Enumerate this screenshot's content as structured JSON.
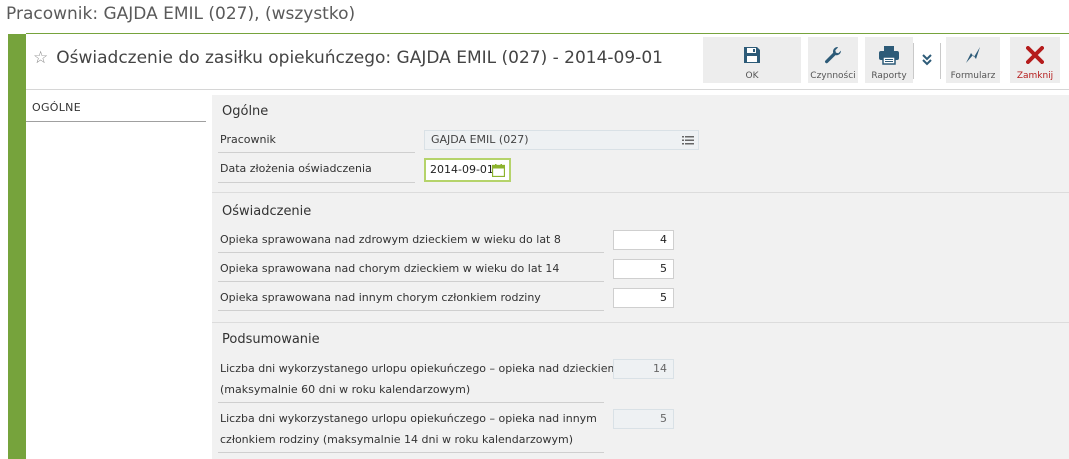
{
  "window": {
    "title": "Pracownik: GAJDA EMIL (027), (wszystko)"
  },
  "form": {
    "title": "Oświadczenie do zasiłku opiekuńczego: GAJDA EMIL (027) - 2014-09-01"
  },
  "toolbar": {
    "ok": "OK",
    "czynnosci": "Czynności",
    "raporty": "Raporty",
    "formularz": "Formularz",
    "zamknij": "Zamknij"
  },
  "sidebar": {
    "items": [
      {
        "label": "OGÓLNE"
      }
    ]
  },
  "sections": {
    "ogolne": {
      "title": "Ogólne",
      "pracownik_label": "Pracownik",
      "pracownik_value": "GAJDA EMIL (027)",
      "data_label": "Data złożenia oświadczenia",
      "data_value": "2014-09-01"
    },
    "oswiadczenie": {
      "title": "Oświadczenie",
      "rows": [
        {
          "label": "Opieka sprawowana nad zdrowym dzieckiem w wieku do lat 8",
          "value": "4"
        },
        {
          "label": "Opieka sprawowana nad chorym dzieckiem w wieku do lat 14",
          "value": "5"
        },
        {
          "label": "Opieka sprawowana nad innym chorym członkiem rodziny",
          "value": "5"
        }
      ]
    },
    "podsumowanie": {
      "title": "Podsumowanie",
      "rows": [
        {
          "label1": "Liczba dni wykorzystanego urlopu opiekuńczego – opieka nad dzieckiem",
          "label2": "(maksymalnie 60 dni w roku kalendarzowym)",
          "value": "14"
        },
        {
          "label1": "Liczba dni wykorzystanego urlopu opiekuńczego – opieka nad innym",
          "label2": "członkiem rodziny (maksymalnie 14 dni w roku kalendarzowym)",
          "value": "5"
        }
      ]
    }
  },
  "colors": {
    "accent_green": "#76a33c",
    "toolbar_icon": "#2d5b78",
    "close_red": "#b51c1c",
    "date_border": "#b5d36a"
  },
  "icons": [
    "save-icon",
    "wrench-icon",
    "printer-icon",
    "chevron-down-icon",
    "lightning-icon",
    "close-icon",
    "star-icon",
    "list-icon",
    "calendar-icon"
  ]
}
